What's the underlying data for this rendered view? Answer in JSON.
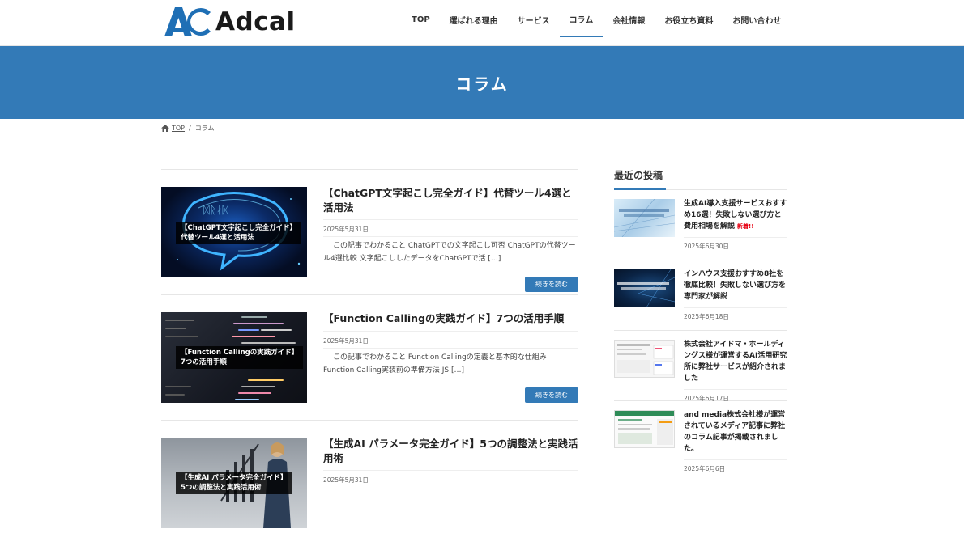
{
  "site": {
    "logo_text": "Adcal",
    "nav": [
      {
        "label": "TOP"
      },
      {
        "label": "選ばれる理由"
      },
      {
        "label": "サービス"
      },
      {
        "label": "コラム",
        "active": true
      },
      {
        "label": "会社情報"
      },
      {
        "label": "お役立ち資料"
      },
      {
        "label": "お問い合わせ"
      }
    ],
    "brand_color": "#337ab7"
  },
  "hero": {
    "title": "コラム"
  },
  "breadcrumb": {
    "home": "TOP",
    "separator": "/",
    "current": "コラム"
  },
  "posts": [
    {
      "title": "【ChatGPT文字起こし完全ガイド】代替ツール4選と活用法",
      "thumb_label_1": "【ChatGPT文字起こし完全ガイド】",
      "thumb_label_2": "代替ツール4選と活用法",
      "date": "2025年5月31日",
      "excerpt": "この記事でわかること ChatGPTでの文字起こし可否 ChatGPTの代替ツール4選比較 文字起こししたデータをChatGPTで活 […]",
      "read_more": "続きを読む"
    },
    {
      "title": "【Function Callingの実践ガイド】7つの活用手順",
      "thumb_label_1": "【Function Callingの実践ガイド】",
      "thumb_label_2": "7つの活用手順",
      "date": "2025年5月31日",
      "excerpt": "この記事でわかること Function Callingの定義と基本的な仕組み Function Calling実装前の準備方法 JS […]",
      "read_more": "続きを読む"
    },
    {
      "title": "【生成AI パラメータ完全ガイド】5つの調整法と実践活用術",
      "thumb_label_1": "【生成AI パラメータ完全ガイド】",
      "thumb_label_2": "5つの調整法と実践活用術",
      "date": "2025年5月31日"
    }
  ],
  "sidebar": {
    "title": "最近の投稿",
    "items": [
      {
        "title": "生成AI導入支援サービスおすすめ16選！失敗しない選び方と費用相場を解説",
        "badge": "新着!!",
        "date": "2025年6月30日"
      },
      {
        "title": "インハウス支援おすすめ8社を徹底比較！失敗しない選び方を専門家が解説",
        "date": "2025年6月18日"
      },
      {
        "title": "株式会社アイドマ・ホールディングス様が運営するAI活用研究所に弊社サービスが紹介されました",
        "date": "2025年6月17日"
      },
      {
        "title": "and media株式会社様が運営されているメディア記事に弊社のコラム記事が掲載されました。",
        "date": "2025年6月6日"
      }
    ]
  }
}
